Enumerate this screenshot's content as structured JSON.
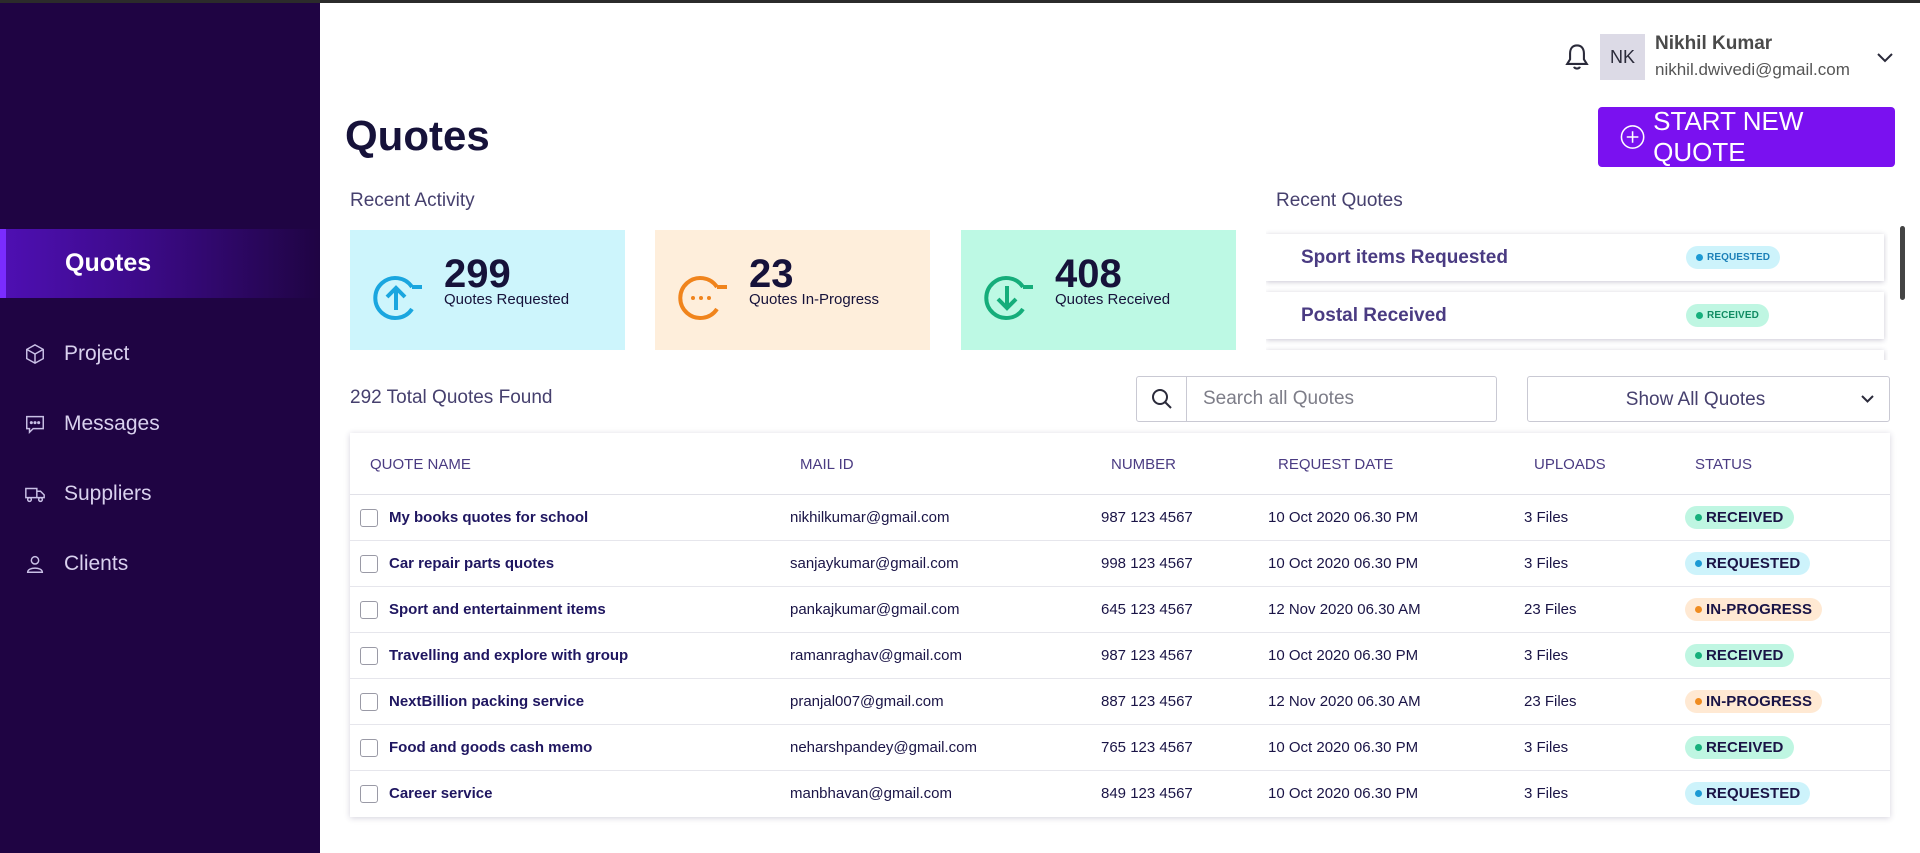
{
  "sidebar": {
    "active": "Quotes",
    "items": [
      {
        "label": "Project",
        "icon": "cube-icon"
      },
      {
        "label": "Messages",
        "icon": "message-icon"
      },
      {
        "label": "Suppliers",
        "icon": "truck-icon"
      },
      {
        "label": "Clients",
        "icon": "person-icon"
      }
    ]
  },
  "header": {
    "avatar_initials": "NK",
    "user_name": "Nikhil Kumar",
    "user_email": "nikhil.dwivedi@gmail.com"
  },
  "page": {
    "title": "Quotes",
    "start_button": "START NEW QUOTE"
  },
  "recent_activity": {
    "label": "Recent Activity",
    "cards": [
      {
        "value": "299",
        "caption": "Quotes Requested",
        "color": "#cdf5fc",
        "icon": "arrow-up-circle-icon"
      },
      {
        "value": "23",
        "caption": "Quotes In-Progress",
        "color": "#feeedb",
        "icon": "dots-circle-icon"
      },
      {
        "value": "408",
        "caption": "Quotes Received",
        "color": "#bdf9e4",
        "icon": "arrow-down-circle-icon"
      }
    ]
  },
  "recent_quotes": {
    "label": "Recent Quotes",
    "items": [
      {
        "title": "Sport items Requested",
        "status": "REQUESTED"
      },
      {
        "title": "Postal Received",
        "status": "RECEIVED"
      }
    ]
  },
  "toolbar": {
    "total": "292 Total Quotes Found",
    "search_placeholder": "Search all Quotes",
    "filter_value": "Show All Quotes"
  },
  "table": {
    "headers": [
      "QUOTE NAME",
      "MAIL ID",
      "NUMBER",
      "REQUEST DATE",
      "UPLOADS",
      "STATUS"
    ],
    "rows": [
      {
        "name": "My books quotes for school",
        "mail": "nikhilkumar@gmail.com",
        "number": "987 123 4567",
        "date": "10 Oct 2020 06.30 PM",
        "uploads": "3 Files",
        "status": "RECEIVED"
      },
      {
        "name": "Car repair parts quotes",
        "mail": "sanjaykumar@gmail.com",
        "number": "998 123 4567",
        "date": "10 Oct 2020 06.30 PM",
        "uploads": "3 Files",
        "status": "REQUESTED"
      },
      {
        "name": "Sport and entertainment items",
        "mail": "pankajkumar@gmail.com",
        "number": "645 123 4567",
        "date": "12 Nov 2020 06.30 AM",
        "uploads": "23 Files",
        "status": "IN-PROGRESS"
      },
      {
        "name": "Travelling and explore with group",
        "mail": "ramanraghav@gmail.com",
        "number": "987 123 4567",
        "date": "10 Oct 2020 06.30 PM",
        "uploads": "3 Files",
        "status": "RECEIVED"
      },
      {
        "name": "NextBillion packing service",
        "mail": "pranjal007@gmail.com",
        "number": "887 123 4567",
        "date": "12 Nov 2020 06.30 AM",
        "uploads": "23 Files",
        "status": "IN-PROGRESS"
      },
      {
        "name": "Food and goods cash memo",
        "mail": "neharshpandey@gmail.com",
        "number": "765 123 4567",
        "date": "10 Oct 2020 06.30 PM",
        "uploads": "3 Files",
        "status": "RECEIVED"
      },
      {
        "name": "Career service",
        "mail": "manbhavan@gmail.com",
        "number": "849 123 4567",
        "date": "10 Oct 2020 06.30 PM",
        "uploads": "3 Files",
        "status": "REQUESTED"
      }
    ]
  },
  "colors": {
    "sidebar": "#1f0443",
    "accent": "#7a11f0",
    "requested": "#1c9ad4",
    "received": "#16b07c",
    "in_progress": "#f08c20"
  }
}
